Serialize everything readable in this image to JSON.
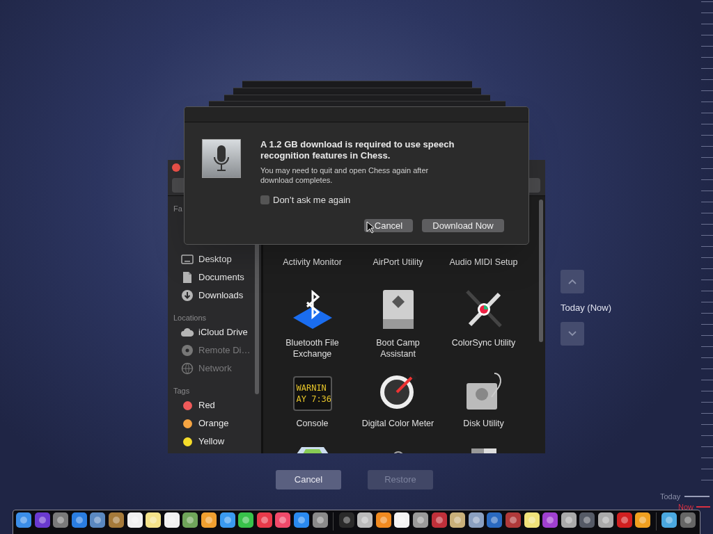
{
  "dialog": {
    "title": "A 1.2 GB download is required to use speech recognition features in Chess.",
    "message": "You may need to quit and open Chess again after download completes.",
    "checkbox": {
      "label": "Don’t ask me again",
      "checked": false
    },
    "buttons": [
      "Cancel",
      "Download Now"
    ]
  },
  "finder": {
    "sidebar": [
      {
        "header": "Fa",
        "items": [
          {
            "label": "Desktop",
            "kind": "desktop",
            "disabled": false
          },
          {
            "label": "Documents",
            "kind": "documents",
            "disabled": false
          },
          {
            "label": "Downloads",
            "kind": "downloads",
            "disabled": false
          }
        ]
      },
      {
        "header": "Locations",
        "items": [
          {
            "label": "iCloud Drive",
            "kind": "cloud",
            "disabled": false
          },
          {
            "label": "Remote Di…",
            "kind": "disc",
            "disabled": true
          },
          {
            "label": "Network",
            "kind": "network",
            "disabled": true
          }
        ]
      },
      {
        "header": "Tags",
        "items": [
          {
            "label": "Red",
            "kind": "tag",
            "color": "#f05a5a",
            "disabled": false
          },
          {
            "label": "Orange",
            "kind": "tag",
            "color": "#f5a442",
            "disabled": false
          },
          {
            "label": "Yellow",
            "kind": "tag",
            "color": "#f5dc2a",
            "disabled": false
          }
        ]
      }
    ],
    "files": [
      {
        "name": "Activity Monitor",
        "kind": "hidden"
      },
      {
        "name": "AirPort Utility",
        "kind": "hidden"
      },
      {
        "name": "Audio MIDI Setup",
        "kind": "hidden"
      },
      {
        "name": "Bluetooth File Exchange",
        "kind": "bluetooth"
      },
      {
        "name": "Boot Camp Assistant",
        "kind": "drive"
      },
      {
        "name": "ColorSync Utility",
        "kind": "tools"
      },
      {
        "name": "Console",
        "kind": "console",
        "screen_text": [
          "WARNIN",
          "AY 7:36"
        ]
      },
      {
        "name": "Digital Color Meter",
        "kind": "meter"
      },
      {
        "name": "Disk Utility",
        "kind": "diskutility"
      },
      {
        "kind": "map"
      },
      {
        "kind": "ring"
      },
      {
        "kind": "slab"
      }
    ]
  },
  "buttons": [
    {
      "label": "Cancel",
      "disabled": false
    },
    {
      "label": "Restore",
      "disabled": true
    }
  ],
  "time_machine": {
    "current": "Today (Now)",
    "timeline": [
      {
        "label": "Today",
        "kind": "today"
      },
      {
        "label": "Now",
        "kind": "now"
      }
    ]
  }
}
